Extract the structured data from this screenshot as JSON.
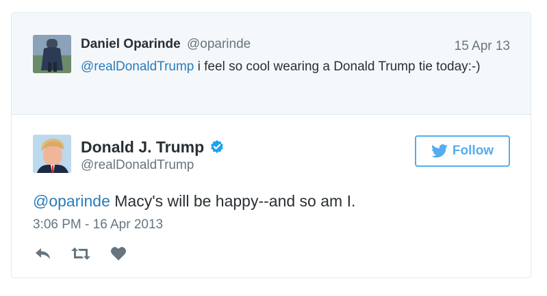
{
  "parent_tweet": {
    "author_name": "Daniel Oparinde",
    "author_handle": "@oparinde",
    "date": "15 Apr 13",
    "mention": "@realDonaldTrump",
    "text": " i feel so cool wearing a Donald Trump tie today:-)",
    "avatar_icon": "user-photo-avatar"
  },
  "main_tweet": {
    "author_name": "Donald J. Trump",
    "author_handle": "@realDonaldTrump",
    "verified_icon": "verified-badge-icon",
    "follow_label": "Follow",
    "mention": "@oparinde",
    "text": " Macy's will be happy--and so am I.",
    "timestamp": "3:06 PM - 16 Apr 2013",
    "avatar_icon": "user-photo-avatar"
  },
  "actions": {
    "reply_icon": "reply-icon",
    "retweet_icon": "retweet-icon",
    "like_icon": "heart-icon"
  },
  "colors": {
    "link": "#2b7bb9",
    "follow": "#55acee",
    "muted": "#66757f",
    "parent_bg": "#f5f8fa",
    "verified": "#1da1f2"
  }
}
